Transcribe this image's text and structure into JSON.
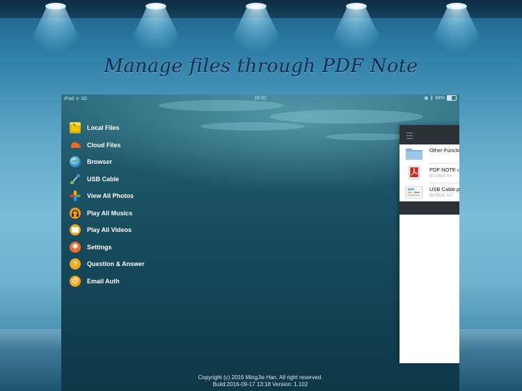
{
  "headline": "Manage files through PDF Note",
  "status_bar": {
    "left": "iPad ᯤ 3G",
    "time": "10:31",
    "battery_text": "48%"
  },
  "menu": {
    "items": [
      {
        "label": "Local Files",
        "icon": "folder-icon"
      },
      {
        "label": "Cloud Files",
        "icon": "cloud-icon"
      },
      {
        "label": "Browser",
        "icon": "globe-icon"
      },
      {
        "label": "USB Cable",
        "icon": "usb-icon"
      },
      {
        "label": "View All Photos",
        "icon": "photos-icon"
      },
      {
        "label": "Play All Musics",
        "icon": "headphones-icon"
      },
      {
        "label": "Play All Videos",
        "icon": "video-icon"
      },
      {
        "label": "Settings",
        "icon": "gear-icon"
      },
      {
        "label": "Question & Answer",
        "icon": "question-icon"
      },
      {
        "label": "Email Auth",
        "icon": "at-icon"
      }
    ]
  },
  "file_panel": {
    "files": [
      {
        "name": "Other Functio",
        "date": "",
        "icon": "folder-icon"
      },
      {
        "name": "PDF NOTE u",
        "date": "9/17/2016, 9:4",
        "icon": "pdf-file-icon"
      },
      {
        "name": "USB Cable.p",
        "date": "9/17/2016, 9:4",
        "icon": "image-file-icon"
      }
    ]
  },
  "footer": {
    "copyright": "Copyright (c) 2016 MingJie Han. All right reserved.",
    "build": "Build:2016-09-17 13:18  Version: 1.102"
  },
  "colors": {
    "background_top": "#1c5f86",
    "background_mid": "#7cbdd8",
    "headline": "#0f2e52",
    "device_water": "#15485a",
    "panel_bar": "#2c3136"
  }
}
